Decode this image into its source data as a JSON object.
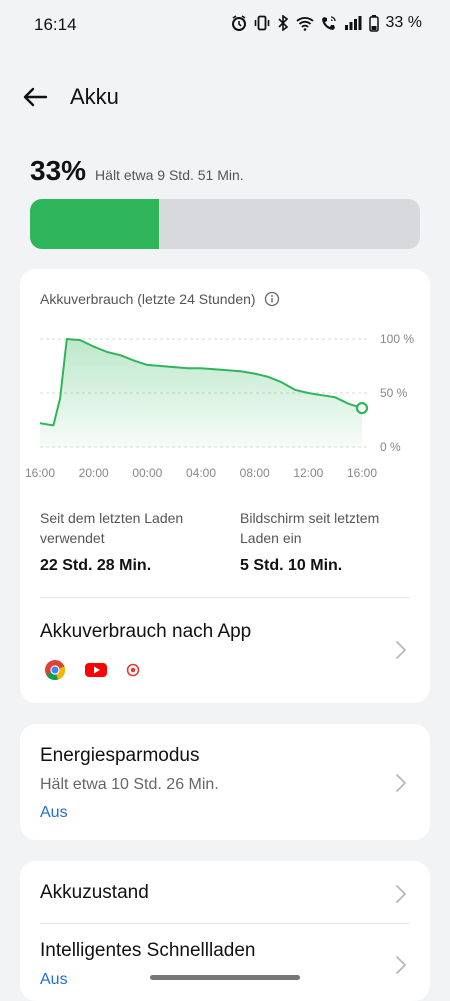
{
  "status_bar": {
    "time": "16:14",
    "battery_text": "33 %",
    "icons": [
      "alarm-icon",
      "vibrate-icon",
      "bluetooth-icon",
      "wifi-icon",
      "wifi-call-icon",
      "signal-icon",
      "battery-icon"
    ]
  },
  "header": {
    "title": "Akku",
    "back_icon": "back-arrow-icon"
  },
  "battery": {
    "percent_label": "33%",
    "level_fraction": 0.33,
    "estimate": "Hält etwa 9 Std. 51 Min.",
    "fill_color": "#2fb55a"
  },
  "usage_card": {
    "title": "Akkuverbrauch (letzte 24 Stunden)",
    "stats": {
      "since_charge_label": "Seit dem letzten Laden verwendet",
      "since_charge_value": "22 Std. 28 Min.",
      "screen_label": "Bildschirm seit letztem Laden ein",
      "screen_value": "5 Std. 10 Min."
    },
    "by_app": {
      "title": "Akkuverbrauch nach App",
      "apps": [
        "chrome-icon",
        "youtube-icon",
        "app-icon-red"
      ]
    }
  },
  "chart_data": {
    "type": "area",
    "title": "Akkuverbrauch (letzte 24 Stunden)",
    "x_ticks": [
      "16:00",
      "20:00",
      "00:00",
      "04:00",
      "08:00",
      "12:00",
      "16:00"
    ],
    "y_ticks": [
      "100 %",
      "50 %",
      "0 %"
    ],
    "ylim": [
      0,
      100
    ],
    "hours": [
      0,
      1,
      1.5,
      2,
      3,
      4,
      5,
      6,
      7,
      8,
      9,
      10,
      11,
      12,
      13,
      14,
      15,
      16,
      17,
      18,
      19,
      20,
      21,
      22,
      23,
      24
    ],
    "values": [
      22,
      20,
      45,
      100,
      99,
      93,
      88,
      85,
      80,
      76,
      75,
      74,
      73,
      73,
      72,
      71,
      70,
      68,
      65,
      60,
      53,
      50,
      48,
      46,
      40,
      36
    ],
    "color": "#2fb55a",
    "grid": true
  },
  "energy_saver": {
    "title": "Energiesparmodus",
    "subtitle": "Hält etwa 10 Std. 26 Min.",
    "status": "Aus"
  },
  "battery_health": {
    "title": "Akkuzustand"
  },
  "smart_charging": {
    "title": "Intelligentes Schnellladen",
    "status": "Aus"
  }
}
